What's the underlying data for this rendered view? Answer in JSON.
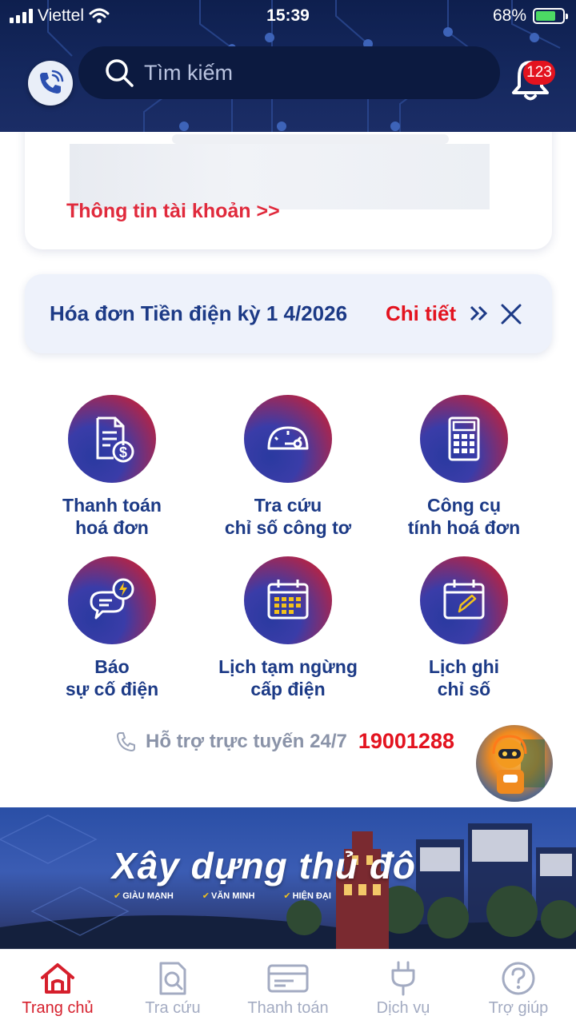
{
  "status_bar": {
    "carrier": "Viettel",
    "time": "15:39",
    "battery_percent": "68%"
  },
  "header": {
    "search_placeholder": "Tìm kiếm",
    "notification_count": "123"
  },
  "account_card": {
    "link_label": "Thông tin tài khoản >>"
  },
  "bill_banner": {
    "title": "Hóa đơn Tiền điện kỳ 1 4/2026",
    "detail_label": "Chi tiết"
  },
  "features": [
    {
      "label": "Thanh toán\nhoá đơn",
      "icon": "invoice-payment-icon"
    },
    {
      "label": "Tra cứu\nchỉ số công tơ",
      "icon": "meter-gauge-icon"
    },
    {
      "label": "Công cụ\ntính hoá đơn",
      "icon": "calculator-icon"
    },
    {
      "label": "Báo\nsự cố điện",
      "icon": "report-incident-icon"
    },
    {
      "label": "Lịch tạm ngừng\ncấp điện",
      "icon": "outage-calendar-icon"
    },
    {
      "label": "Lịch ghi\nchỉ số",
      "icon": "reading-schedule-icon"
    }
  ],
  "hotline": {
    "label": "Hỗ trợ trực tuyến 24/7",
    "number": "19001288"
  },
  "promo": {
    "title": "Xây dựng thủ đô",
    "tags": [
      "GIÀU MẠNH",
      "VĂN MINH",
      "HIỆN ĐẠI"
    ]
  },
  "bottom_nav": [
    {
      "label": "Trang chủ",
      "icon": "home-icon",
      "active": true
    },
    {
      "label": "Tra cứu",
      "icon": "lookup-document-icon",
      "active": false
    },
    {
      "label": "Thanh toán",
      "icon": "payment-card-icon",
      "active": false
    },
    {
      "label": "Dịch vụ",
      "icon": "plug-icon",
      "active": false
    },
    {
      "label": "Trợ giúp",
      "icon": "help-icon",
      "active": false
    }
  ],
  "colors": {
    "brand_navy": "#1c3a86",
    "brand_red": "#e3131f",
    "header_bg": "#15285e"
  }
}
